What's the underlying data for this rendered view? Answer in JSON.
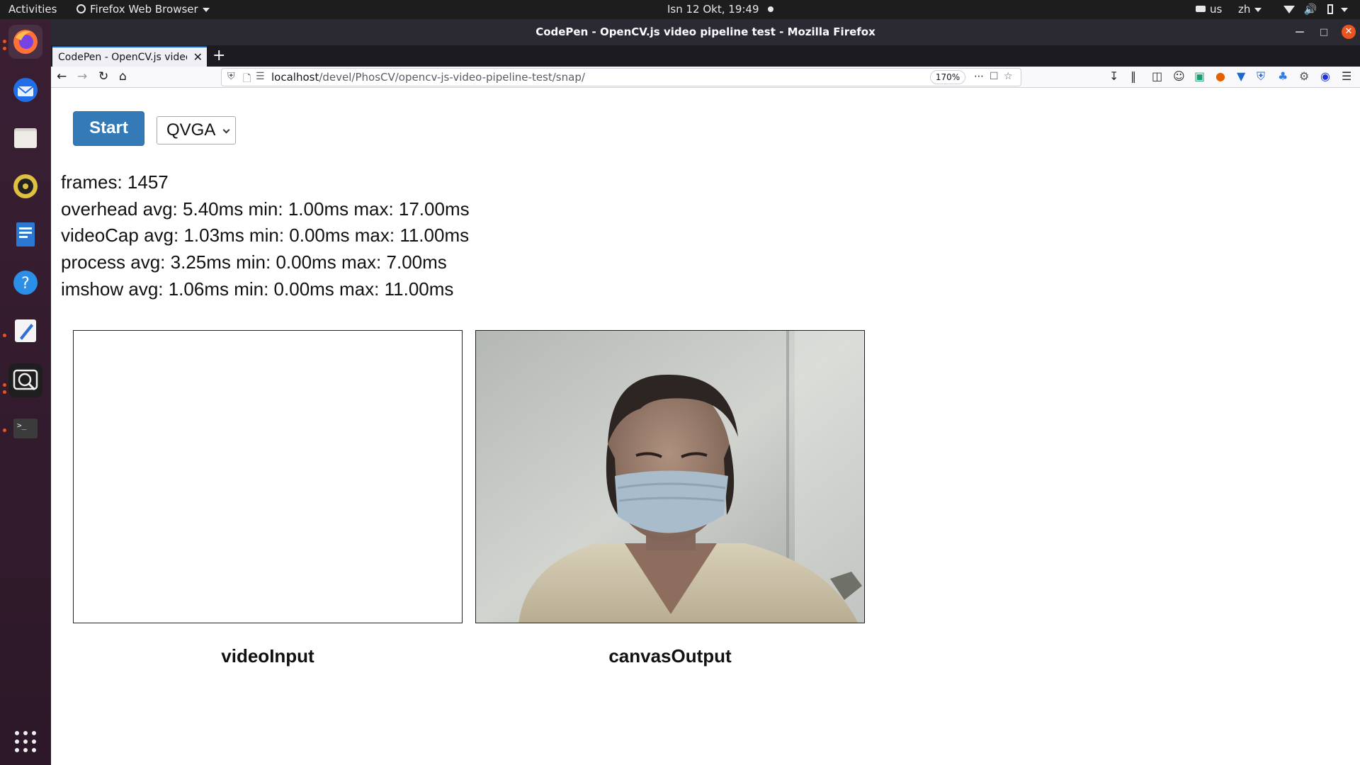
{
  "topbar": {
    "activities": "Activities",
    "app_menu": "Firefox Web Browser",
    "clock": "Isn 12 Okt, 19:49",
    "keyboard_layout": "us",
    "input_method": "zh"
  },
  "window": {
    "title": "CodePen - OpenCV.js video pipeline test - Mozilla Firefox"
  },
  "tabs": [
    {
      "label": "CodePen - OpenCV.js video pipe"
    }
  ],
  "urlbar": {
    "host": "localhost",
    "path": "/devel/PhosCV/opencv-js-video-pipeline-test/snap/",
    "zoom": "170%"
  },
  "controls": {
    "start_label": "Start",
    "resolution_selected": "QVGA"
  },
  "stats": [
    "frames: 1457",
    "overhead avg: 5.40ms min: 1.00ms max: 17.00ms",
    "videoCap avg: 1.03ms min: 0.00ms max: 11.00ms",
    "process avg: 3.25ms min: 0.00ms max: 7.00ms",
    "imshow avg: 1.06ms min: 0.00ms max: 11.00ms"
  ],
  "canvases": {
    "input_label": "videoInput",
    "output_label": "canvasOutput"
  },
  "colors": {
    "accent": "#337ab7",
    "ubuntu_orange": "#e95420",
    "dock": "#3a1f33"
  }
}
